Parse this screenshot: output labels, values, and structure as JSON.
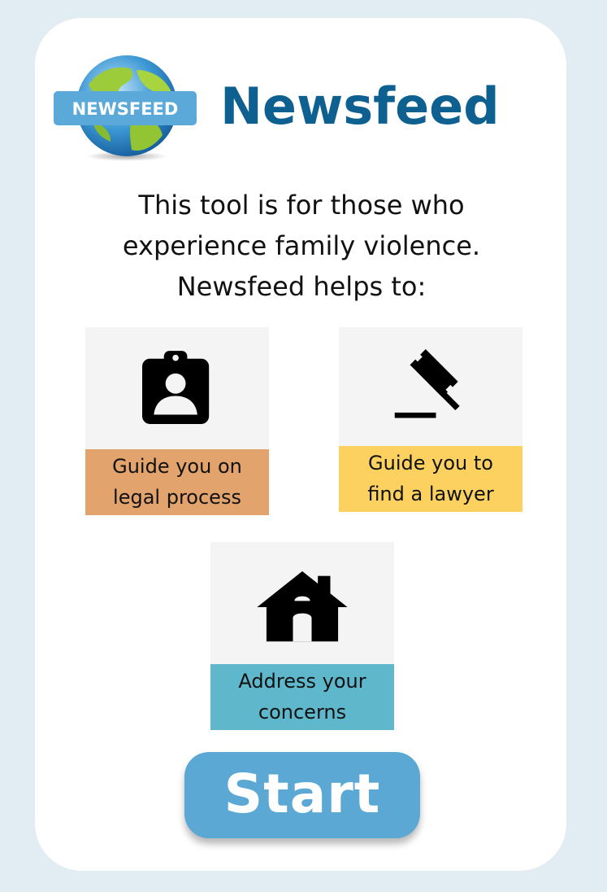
{
  "app": {
    "title": "Newsfeed",
    "logo_badge_text": "NEWSFEED"
  },
  "intro": {
    "line1": "This tool is for those who",
    "line2": "experience family violence.",
    "line3": "Newsfeed helps to:"
  },
  "features": [
    {
      "icon": "clipboard-person-icon",
      "line1": "Guide you on",
      "line2": "legal process",
      "color": "#e2a36d"
    },
    {
      "icon": "gavel-icon",
      "line1": "Guide you to",
      "line2": "find a lawyer",
      "color": "#fcd160"
    },
    {
      "icon": "house-icon",
      "line1": "Address your",
      "line2": "concerns",
      "color": "#5fb7cb"
    }
  ],
  "start_button": {
    "label": "Start",
    "color": "#5aa8d3"
  },
  "colors": {
    "title": "#0e6090",
    "page_background": "#e2ecf3"
  }
}
